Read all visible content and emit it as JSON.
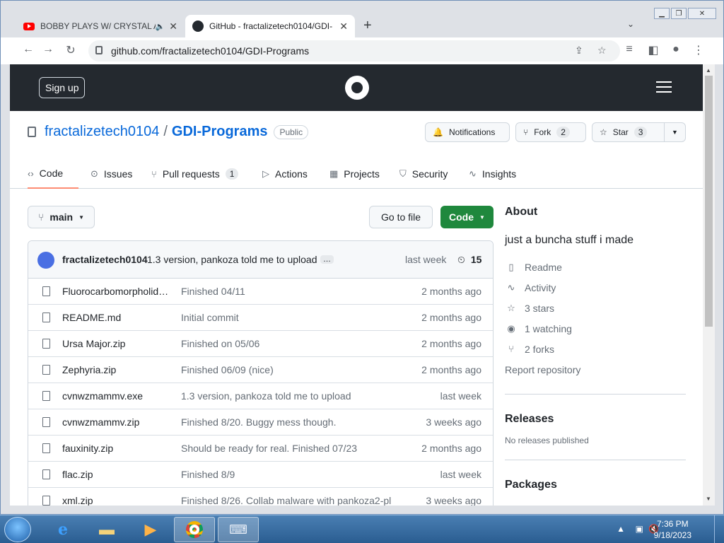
{
  "browser": {
    "tabs": [
      {
        "title": "BOBBY PLAYS W/ CRYSTAL A",
        "icon": "youtube-icon",
        "audio": "speaker-icon"
      },
      {
        "title": "GitHub - fractalizetech0104/GDI-",
        "icon": "github-icon"
      }
    ],
    "close_glyph": "✕",
    "new_tab_glyph": "+",
    "tab_search_glyph": "⌄",
    "url": "github.com/fractalizetech0104/GDI-Programs"
  },
  "header": {
    "signup": "Sign up"
  },
  "repo": {
    "owner": "fractalizetech0104",
    "separator": "/",
    "name": "GDI-Programs",
    "visibility": "Public",
    "notifications": "Notifications",
    "fork_label": "Fork",
    "fork_count": "2",
    "star_label": "Star",
    "star_count": "3"
  },
  "nav": [
    {
      "label": "Code",
      "icon": "‹›"
    },
    {
      "label": "Issues",
      "icon": "⊙"
    },
    {
      "label": "Pull requests",
      "icon": "⑂",
      "count": "1"
    },
    {
      "label": "Actions",
      "icon": "▷"
    },
    {
      "label": "Projects",
      "icon": "▦"
    },
    {
      "label": "Security",
      "icon": "⛉"
    },
    {
      "label": "Insights",
      "icon": "∿"
    }
  ],
  "toolbar": {
    "branch": "main",
    "go_to_file": "Go to file",
    "code": "Code"
  },
  "commit": {
    "author": "fractalizetech0104",
    "message": "1.3 version, pankoza told me to upload",
    "dots": "…",
    "when": "last week",
    "count": "15"
  },
  "files": [
    {
      "name": "Fluorocarbomorpholid…",
      "message": "Finished 04/11",
      "age": "2 months ago"
    },
    {
      "name": "README.md",
      "message": "Initial commit",
      "age": "2 months ago"
    },
    {
      "name": "Ursa Major.zip",
      "message": "Finished on 05/06",
      "age": "2 months ago"
    },
    {
      "name": "Zephyria.zip",
      "message": "Finished 06/09 (nice)",
      "age": "2 months ago"
    },
    {
      "name": "cvnwzmammv.exe",
      "message": "1.3 version, pankoza told me to upload",
      "age": "last week"
    },
    {
      "name": "cvnwzmammv.zip",
      "message": "Finished 8/20. Buggy mess though.",
      "age": "3 weeks ago"
    },
    {
      "name": "fauxinity.zip",
      "message": "Should be ready for real. Finished 07/23",
      "age": "2 months ago"
    },
    {
      "name": "flac.zip",
      "message": "Finished 8/9",
      "age": "last week"
    },
    {
      "name": "xml.zip",
      "message": "Finished 8/26. Collab malware with pankoza2-pl",
      "age": "3 weeks ago"
    }
  ],
  "about": {
    "title": "About",
    "description": "just a buncha stuff i made",
    "readme": "Readme",
    "activity": "Activity",
    "stars": "3 stars",
    "watching": "1 watching",
    "forks": "2 forks",
    "report": "Report repository"
  },
  "releases": {
    "title": "Releases",
    "empty": "No releases published"
  },
  "packages": {
    "title": "Packages"
  },
  "taskbar": {
    "time": "7:36 PM",
    "date": "9/18/2023"
  }
}
